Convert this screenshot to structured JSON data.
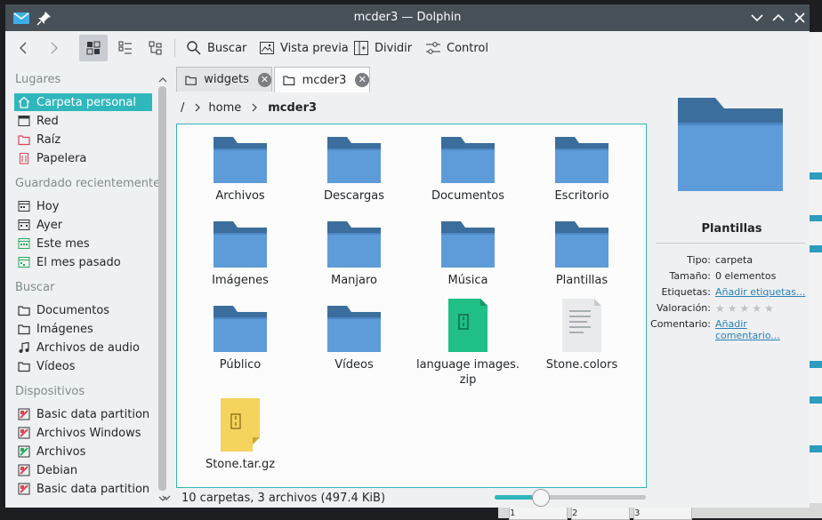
{
  "window": {
    "title": "mcder3 — Dolphin"
  },
  "toolbar": {
    "search": "Buscar",
    "preview": "Vista previa",
    "split": "Dividir",
    "control": "Control"
  },
  "sidebar": {
    "sections": [
      {
        "title": "Lugares",
        "items": [
          {
            "label": "Carpeta personal",
            "icon": "home-icon",
            "selected": true
          },
          {
            "label": "Red",
            "icon": "network-icon"
          },
          {
            "label": "Raíz",
            "icon": "root-folder-icon"
          },
          {
            "label": "Papelera",
            "icon": "trash-icon"
          }
        ]
      },
      {
        "title": "Guardado recientemente",
        "items": [
          {
            "label": "Hoy",
            "icon": "calendar-icon"
          },
          {
            "label": "Ayer",
            "icon": "calendar-icon"
          },
          {
            "label": "Este mes",
            "icon": "calendar-icon"
          },
          {
            "label": "El mes pasado",
            "icon": "calendar-icon"
          }
        ]
      },
      {
        "title": "Buscar",
        "items": [
          {
            "label": "Documentos",
            "icon": "folder-icon"
          },
          {
            "label": "Imágenes",
            "icon": "folder-icon"
          },
          {
            "label": "Archivos de audio",
            "icon": "music-icon"
          },
          {
            "label": "Vídeos",
            "icon": "folder-icon"
          }
        ]
      },
      {
        "title": "Dispositivos",
        "items": [
          {
            "label": "Basic data partition",
            "icon": "drive-red-icon"
          },
          {
            "label": "Archivos Windows",
            "icon": "drive-red-icon"
          },
          {
            "label": "Archivos",
            "icon": "drive-green-icon"
          },
          {
            "label": "Debian",
            "icon": "drive-red-icon"
          },
          {
            "label": "Basic data partition",
            "icon": "drive-red-icon"
          }
        ]
      }
    ]
  },
  "tabs": [
    {
      "label": "widgets",
      "active": false
    },
    {
      "label": "mcder3",
      "active": true
    }
  ],
  "breadcrumb": {
    "root": "/",
    "home": "home",
    "current": "mcder3"
  },
  "files": [
    {
      "name": "Archivos",
      "type": "folder"
    },
    {
      "name": "Descargas",
      "type": "folder"
    },
    {
      "name": "Documentos",
      "type": "folder"
    },
    {
      "name": "Escritorio",
      "type": "folder"
    },
    {
      "name": "Imágenes",
      "type": "folder"
    },
    {
      "name": "Manjaro",
      "type": "folder"
    },
    {
      "name": "Música",
      "type": "folder"
    },
    {
      "name": "Plantillas",
      "type": "folder"
    },
    {
      "name": "Público",
      "type": "folder"
    },
    {
      "name": "Vídeos",
      "type": "folder"
    },
    {
      "name": "language images.\nzip",
      "type": "zip"
    },
    {
      "name": "Stone.colors",
      "type": "text"
    },
    {
      "name": "Stone.tar.gz",
      "type": "tar"
    }
  ],
  "status": {
    "text": "10 carpetas, 3 archivos (497.4 KiB)",
    "zoom": 0.3
  },
  "info": {
    "name": "Plantillas",
    "rows": {
      "tipo_k": "Tipo:",
      "tipo_v": "carpeta",
      "tam_k": "Tamaño:",
      "tam_v": "0 elementos",
      "etq_k": "Etiquetas:",
      "etq_v": "Añadir etiquetas...",
      "val_k": "Valoración:",
      "com_k": "Comentario:",
      "com_v": "Añadir comentario..."
    },
    "rating": 0
  },
  "colors": {
    "accent": "#30b7bb",
    "titlebar": "#475057",
    "folder": "#5b95d4",
    "link": "#2980b9"
  }
}
